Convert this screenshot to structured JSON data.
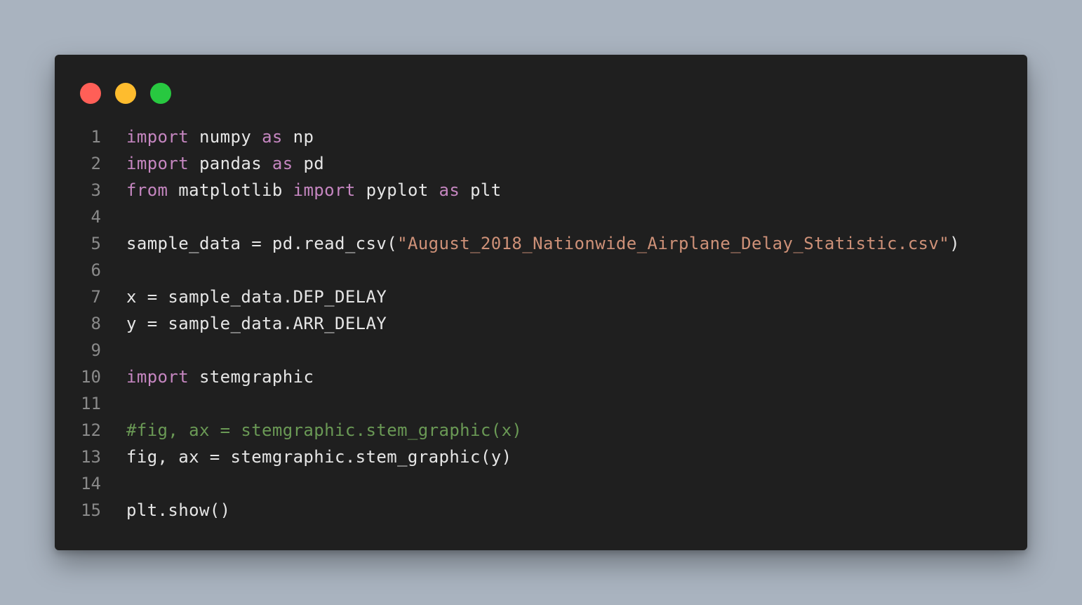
{
  "window": {
    "controls": [
      {
        "name": "close",
        "color": "#ff5f57"
      },
      {
        "name": "minimize",
        "color": "#febc2e"
      },
      {
        "name": "maximize",
        "color": "#28c840"
      }
    ]
  },
  "colors": {
    "background": "#a9b3bf",
    "editor": "#1f1f1f",
    "keyword": "#c586c0",
    "string": "#ce9178",
    "comment": "#6a9955",
    "text": "#e6e6e6",
    "line_number": "#8a8a8a"
  },
  "code": {
    "lines": [
      {
        "n": "1",
        "tokens": [
          {
            "t": "import",
            "c": "kw"
          },
          {
            "t": " numpy ",
            "c": ""
          },
          {
            "t": "as",
            "c": "kw"
          },
          {
            "t": " np",
            "c": ""
          }
        ]
      },
      {
        "n": "2",
        "tokens": [
          {
            "t": "import",
            "c": "kw"
          },
          {
            "t": " pandas ",
            "c": ""
          },
          {
            "t": "as",
            "c": "kw"
          },
          {
            "t": " pd",
            "c": ""
          }
        ]
      },
      {
        "n": "3",
        "tokens": [
          {
            "t": "from",
            "c": "kw"
          },
          {
            "t": " matplotlib ",
            "c": ""
          },
          {
            "t": "import",
            "c": "kw"
          },
          {
            "t": " pyplot ",
            "c": ""
          },
          {
            "t": "as",
            "c": "kw"
          },
          {
            "t": " plt",
            "c": ""
          }
        ]
      },
      {
        "n": "4",
        "tokens": []
      },
      {
        "n": "5",
        "tokens": [
          {
            "t": "sample_data = pd.read_csv(",
            "c": ""
          },
          {
            "t": "\"August_2018_Nationwide_Airplane_Delay_Statistic.csv\"",
            "c": "str"
          },
          {
            "t": ")",
            "c": ""
          }
        ]
      },
      {
        "n": "6",
        "tokens": []
      },
      {
        "n": "7",
        "tokens": [
          {
            "t": "x = sample_data.DEP_DELAY",
            "c": ""
          }
        ]
      },
      {
        "n": "8",
        "tokens": [
          {
            "t": "y = sample_data.ARR_DELAY",
            "c": ""
          }
        ]
      },
      {
        "n": "9",
        "tokens": []
      },
      {
        "n": "10",
        "tokens": [
          {
            "t": "import",
            "c": "kw"
          },
          {
            "t": " stemgraphic",
            "c": ""
          }
        ]
      },
      {
        "n": "11",
        "tokens": []
      },
      {
        "n": "12",
        "tokens": [
          {
            "t": "#fig, ax = stemgraphic.stem_graphic(x)",
            "c": "cm"
          }
        ]
      },
      {
        "n": "13",
        "tokens": [
          {
            "t": "fig, ax = stemgraphic.stem_graphic(y)",
            "c": ""
          }
        ]
      },
      {
        "n": "14",
        "tokens": []
      },
      {
        "n": "15",
        "tokens": [
          {
            "t": "plt.show()",
            "c": ""
          }
        ]
      }
    ]
  }
}
